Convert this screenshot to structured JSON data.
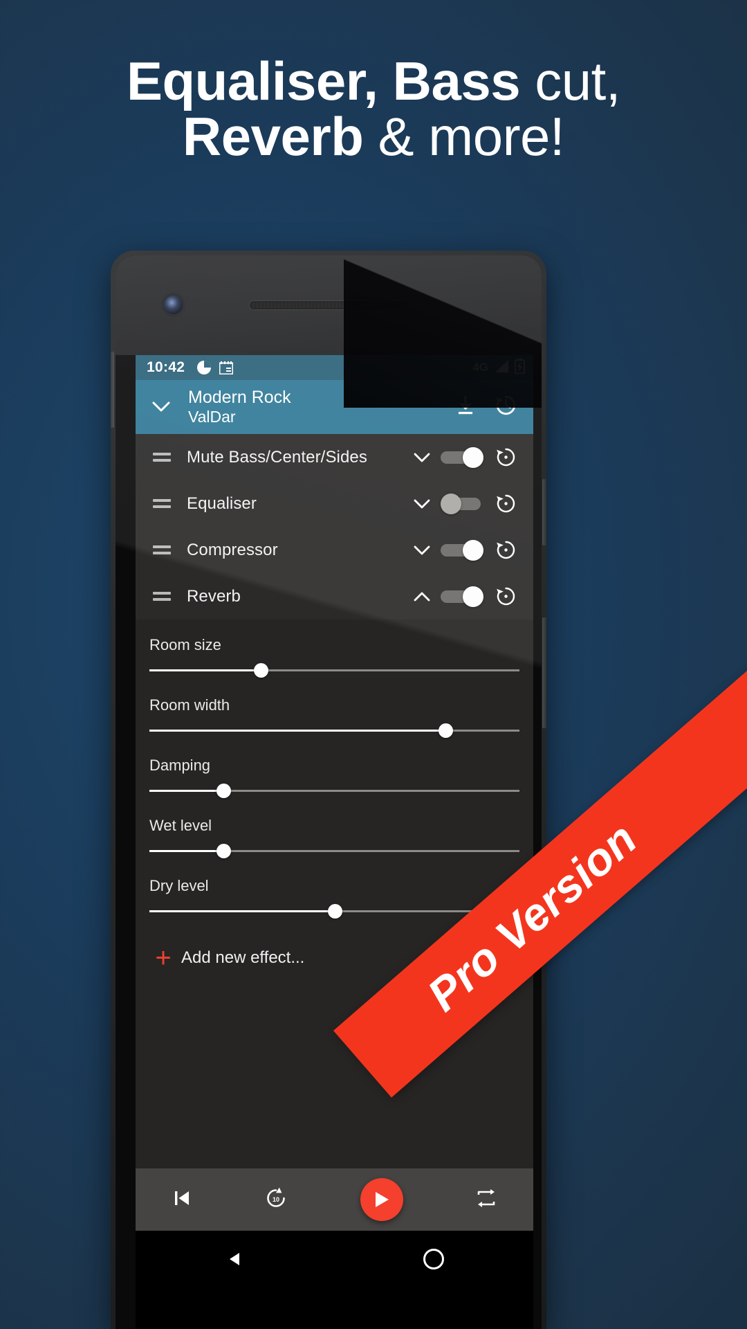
{
  "headline": {
    "line1_bold": "Equaliser, Bass",
    "line1_light": " cut,",
    "line2_bold": "Reverb",
    "line2_light": " & more!"
  },
  "colors": {
    "background_top": "#1e486c",
    "background_bottom": "#17293a",
    "statusbar": "#2b6279",
    "appbar": "#317997",
    "accent_red": "#f4402d",
    "ribbon_red": "#f4351e",
    "screen_bg": "#262524",
    "row_bg": "#2b2a29"
  },
  "phone": {
    "statusbar": {
      "time": "10:42",
      "left_icons": [
        "pie-chart-icon",
        "calendar-icon"
      ],
      "network": "4G",
      "right_icons": [
        "signal-bars-icon",
        "battery-charging-icon"
      ]
    },
    "appbar": {
      "expand_icon": "chevron-down-icon",
      "title": "Modern Rock",
      "subtitle": "ValDar",
      "actions": [
        "download-icon",
        "history-restore-icon"
      ]
    },
    "effects": [
      {
        "name": "Mute Bass/Center/Sides",
        "chevron": "chevron-down-icon",
        "enabled": true,
        "reset_icon": "restore-icon"
      },
      {
        "name": "Equaliser",
        "chevron": "chevron-down-icon",
        "enabled": false,
        "reset_icon": "restore-icon"
      },
      {
        "name": "Compressor",
        "chevron": "chevron-down-icon",
        "enabled": true,
        "reset_icon": "restore-icon"
      },
      {
        "name": "Reverb",
        "chevron": "chevron-up-icon",
        "enabled": true,
        "reset_icon": "restore-icon"
      }
    ],
    "sliders": [
      {
        "label": "Room size",
        "value": 30
      },
      {
        "label": "Room width",
        "value": 80
      },
      {
        "label": "Damping",
        "value": 20
      },
      {
        "label": "Wet level",
        "value": 20
      },
      {
        "label": "Dry level",
        "value": 50
      }
    ],
    "add_effect": {
      "icon": "plus-icon",
      "label": "Add new effect..."
    },
    "player": {
      "buttons": [
        "previous-track-icon",
        "replay-10-icon",
        "play-icon",
        "repeat-icon"
      ],
      "replay_seconds": "10"
    },
    "navbar": {
      "buttons": [
        "back-icon",
        "home-icon"
      ]
    }
  },
  "ribbon": {
    "text": "Pro Version"
  }
}
